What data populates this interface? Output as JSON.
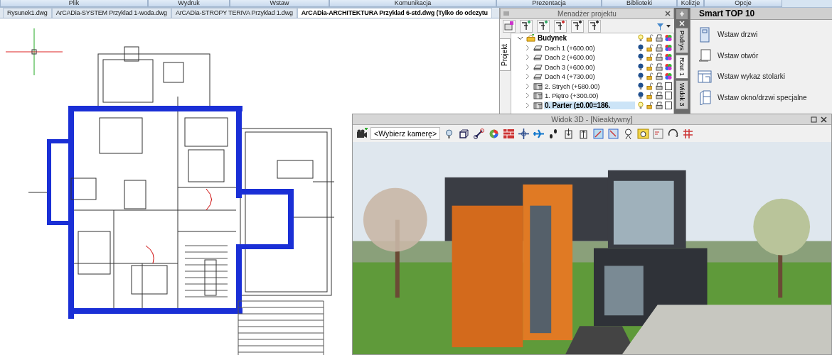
{
  "menu": [
    {
      "label": "Plik"
    },
    {
      "label": "Wydruk"
    },
    {
      "label": "Wstaw"
    },
    {
      "label": "Komunikacja"
    },
    {
      "label": "Prezentacja"
    },
    {
      "label": "Biblioteki"
    },
    {
      "label": "Kolizje"
    },
    {
      "label": "Opcje"
    }
  ],
  "tabs": [
    {
      "label": "Rysunek1.dwg",
      "selected": false
    },
    {
      "label": "ArCADia-SYSTEM Przyklad 1-woda.dwg",
      "selected": false
    },
    {
      "label": "ArCADia-STROPY TERIVA Przyklad 1.dwg",
      "selected": false
    },
    {
      "label": "ArCADia-ARCHITEKTURA Przyklad 6-std.dwg (Tylko do odczytu",
      "selected": true
    }
  ],
  "project_manager": {
    "title": "Menadżer projektu",
    "side_tab": {
      "label": "Projekt",
      "selected": true
    },
    "tree": [
      {
        "label": "Budynek",
        "kind": "building",
        "expanded": true,
        "selected": false,
        "active": true,
        "children": [
          {
            "label": "Dach 1 (+600.00)",
            "kind": "roof",
            "expanded": false,
            "selected": false,
            "active": false
          },
          {
            "label": "Dach 2 (+600.00)",
            "kind": "roof",
            "expanded": false,
            "selected": false,
            "active": false
          },
          {
            "label": "Dach 3 (+600.00)",
            "kind": "roof",
            "expanded": false,
            "selected": false,
            "active": false
          },
          {
            "label": "Dach 4 (+730.00)",
            "kind": "roof",
            "expanded": false,
            "selected": false,
            "active": false
          },
          {
            "label": "2. Strych (+580.00)",
            "kind": "floor",
            "expanded": false,
            "selected": false,
            "active": false
          },
          {
            "label": "1. Piętro (+300.00)",
            "kind": "floor",
            "expanded": false,
            "selected": false,
            "active": false
          },
          {
            "label": "0. Parter (±0.00=186.",
            "kind": "floor",
            "expanded": false,
            "selected": true,
            "active": true
          }
        ]
      }
    ]
  },
  "add_button": {
    "label": "+"
  },
  "view_tabs": [
    {
      "label": "Podrys",
      "selected": false
    },
    {
      "label": "Rzut 1",
      "selected": true
    },
    {
      "label": "Widok 3",
      "selected": false
    }
  ],
  "smart_panel": {
    "title": "Smart TOP 10",
    "items": [
      {
        "label": "Wstaw drzwi",
        "kind": "door"
      },
      {
        "label": "Wstaw otwór",
        "kind": "opening"
      },
      {
        "label": "Wstaw wykaz stolarki",
        "kind": "schedule"
      },
      {
        "label": "Wstaw okno/drzwi specjalne",
        "kind": "window"
      }
    ]
  },
  "view_3d": {
    "title": "Widok 3D - [Nieaktywny]",
    "camera_select": "<Wybierz kamerę>"
  }
}
